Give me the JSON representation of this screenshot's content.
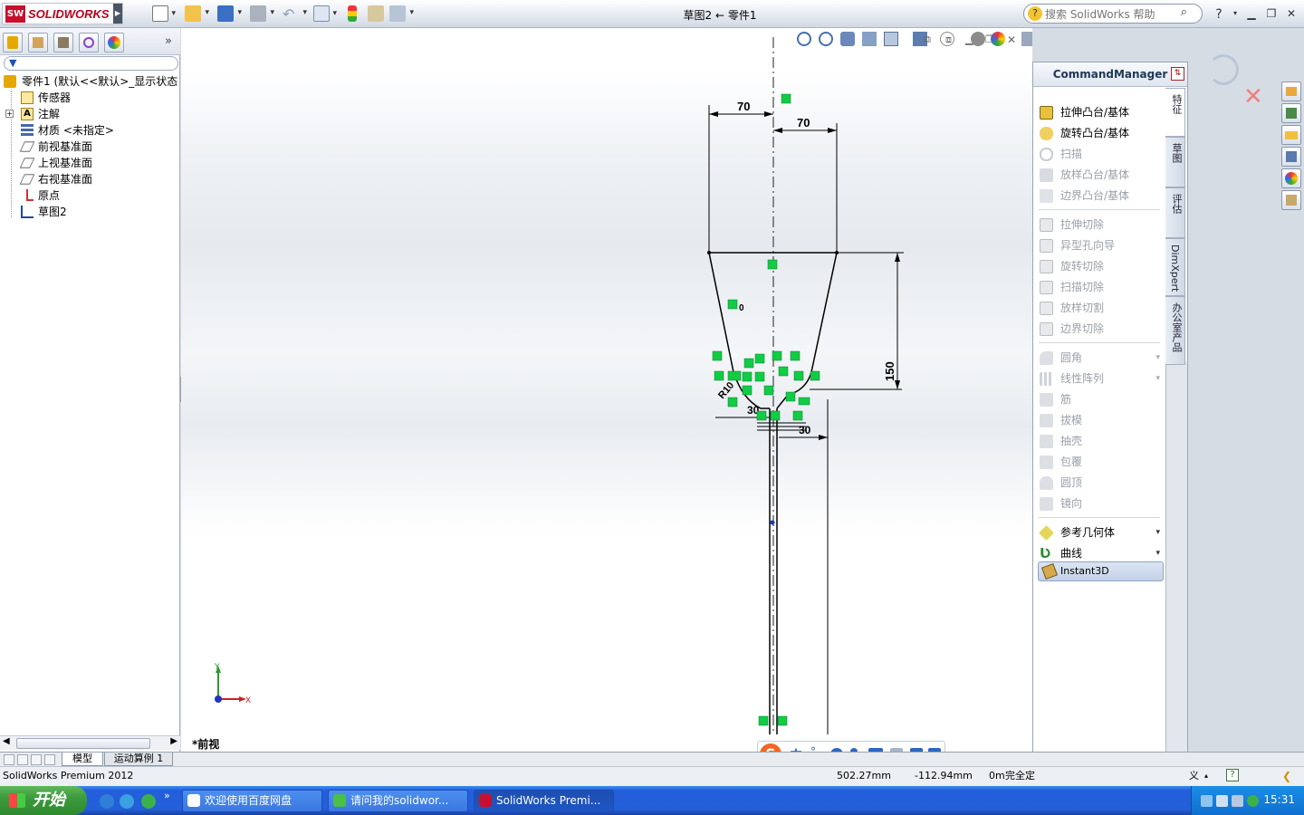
{
  "titlebar": {
    "brand": "SOLIDWORKS",
    "brand_short": "SW",
    "doc_title": "草图2 ← 零件1",
    "help_search_placeholder": "搜索 SolidWorks 帮助",
    "help_label": "?"
  },
  "feature_tree": {
    "filter_placeholder": "",
    "items": [
      {
        "label": "零件1  (默认<<默认>_显示状态",
        "icon": "part-icon"
      },
      {
        "label": "传感器",
        "icon": "sensor-icon"
      },
      {
        "label": "注解",
        "icon": "annotation-icon"
      },
      {
        "label": "材质 <未指定>",
        "icon": "material-icon"
      },
      {
        "label": "前视基准面",
        "icon": "plane-icon"
      },
      {
        "label": "上视基准面",
        "icon": "plane-icon"
      },
      {
        "label": "右视基准面",
        "icon": "plane-icon"
      },
      {
        "label": "原点",
        "icon": "origin-icon"
      },
      {
        "label": "草图2",
        "icon": "sketch-icon"
      }
    ]
  },
  "graphics": {
    "view_label": "*前视",
    "triad_x": "X",
    "triad_y": "Y",
    "dimensions": {
      "top_left": "70",
      "top_right": "70",
      "height": "150",
      "lower": "30",
      "lower2": "30"
    },
    "sketch_labels": {
      "r_label": "R10",
      "small_0": "0"
    }
  },
  "command_manager": {
    "title": "CommandManager",
    "items": [
      {
        "label": "拉伸凸台/基体",
        "enabled": true,
        "icon": "extrude-boss-icon"
      },
      {
        "label": "旋转凸台/基体",
        "enabled": true,
        "icon": "revolve-boss-icon"
      },
      {
        "label": "扫描",
        "enabled": false,
        "icon": "sweep-icon"
      },
      {
        "label": "放样凸台/基体",
        "enabled": false,
        "icon": "loft-icon"
      },
      {
        "label": "边界凸台/基体",
        "enabled": false,
        "icon": "boundary-boss-icon"
      }
    ],
    "cut_items": [
      {
        "label": "拉伸切除",
        "icon": "extrude-cut-icon"
      },
      {
        "label": "异型孔向导",
        "icon": "hole-wizard-icon"
      },
      {
        "label": "旋转切除",
        "icon": "revolve-cut-icon"
      },
      {
        "label": "扫描切除",
        "icon": "sweep-cut-icon"
      },
      {
        "label": "放样切割",
        "icon": "loft-cut-icon"
      },
      {
        "label": "边界切除",
        "icon": "boundary-cut-icon"
      }
    ],
    "feature_items": [
      {
        "label": "圆角",
        "dropdown": true,
        "icon": "fillet-icon"
      },
      {
        "label": "线性阵列",
        "dropdown": true,
        "icon": "linear-pattern-icon"
      },
      {
        "label": "筋",
        "dropdown": false,
        "icon": "rib-icon"
      },
      {
        "label": "拔模",
        "dropdown": false,
        "icon": "draft-icon"
      },
      {
        "label": "抽壳",
        "dropdown": false,
        "icon": "shell-icon"
      },
      {
        "label": "包覆",
        "dropdown": false,
        "icon": "wrap-icon"
      },
      {
        "label": "圆顶",
        "dropdown": false,
        "icon": "dome-icon"
      },
      {
        "label": "镜向",
        "dropdown": false,
        "icon": "mirror-icon"
      }
    ],
    "ref_items": [
      {
        "label": "参考几何体",
        "icon": "reference-geometry-icon"
      },
      {
        "label": "曲线",
        "icon": "curves-icon"
      }
    ],
    "instant3d": "Instant3D",
    "tabs": [
      "特征",
      "草图",
      "评估",
      "DimXpert",
      "办公室产品"
    ]
  },
  "bottom_tabs": [
    "模型",
    "运动算例 1"
  ],
  "status": {
    "product": "SolidWorks Premium 2012",
    "x_coord": "502.27mm",
    "y_coord": "-112.94mm",
    "z_coord": "0m",
    "state": "完全定",
    "custom": "义"
  },
  "ime": {
    "logo": "S",
    "mode": "中"
  },
  "taskbar": {
    "start": "开始",
    "tasks": [
      {
        "label": "欢迎使用百度网盘",
        "active": false
      },
      {
        "label": "请问我的solidwor...",
        "active": false
      },
      {
        "label": "SolidWorks Premi...",
        "active": true
      }
    ],
    "clock": "15:31"
  },
  "colors": {
    "accent": "#245edb",
    "sw_red": "#c8102e",
    "sketch_green": "#11cc44",
    "sketch_line": "#000000"
  }
}
